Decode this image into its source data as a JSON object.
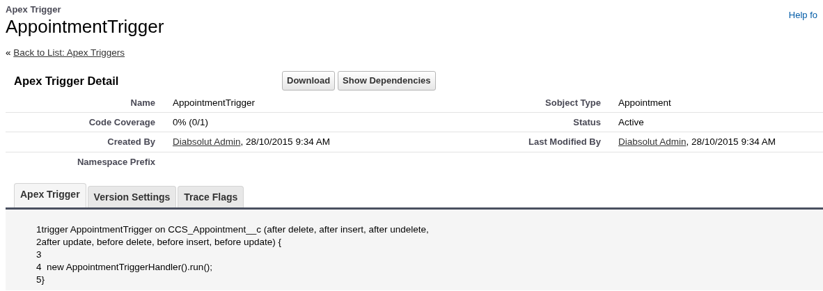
{
  "header": {
    "kicker": "Apex Trigger",
    "title": "AppointmentTrigger",
    "help_link": "Help fo"
  },
  "back": {
    "mark": "«",
    "link": "Back to List: Apex Triggers"
  },
  "detail": {
    "title": "Apex Trigger Detail",
    "buttons": [
      "Download",
      "Show Dependencies"
    ],
    "rows": [
      [
        {
          "label": "Name",
          "kind": "text",
          "value": "AppointmentTrigger"
        },
        {
          "label": "Sobject Type",
          "kind": "text",
          "value": "Appointment"
        }
      ],
      [
        {
          "label": "Code Coverage",
          "kind": "text",
          "value": "0% (0/1)"
        },
        {
          "label": "Status",
          "kind": "text",
          "value": "Active"
        }
      ],
      [
        {
          "label": "Created By",
          "kind": "user",
          "user": "Diabsolut Admin",
          "value": ", 28/10/2015 9:34 AM"
        },
        {
          "label": "Last Modified By",
          "kind": "user",
          "user": "Diabsolut Admin",
          "value": ", 28/10/2015 9:34 AM"
        }
      ],
      [
        {
          "label": "Namespace Prefix",
          "kind": "text"
        },
        null
      ]
    ]
  },
  "tabs": [
    {
      "label": "Apex Trigger",
      "selected": true
    },
    {
      "label": "Version Settings",
      "selected": false
    },
    {
      "label": "Trace Flags",
      "selected": false
    }
  ],
  "code": [
    {
      "number": "1",
      "text": "trigger AppointmentTrigger on CCS_Appointment__c (after delete, after insert, after undelete,"
    },
    {
      "number": "2",
      "text": "after update, before delete, before insert, before update) {"
    },
    {
      "number": "3"
    },
    {
      "number": "4",
      "text": "  new AppointmentTriggerHandler().run();"
    },
    {
      "number": "5",
      "text": "}"
    }
  ]
}
